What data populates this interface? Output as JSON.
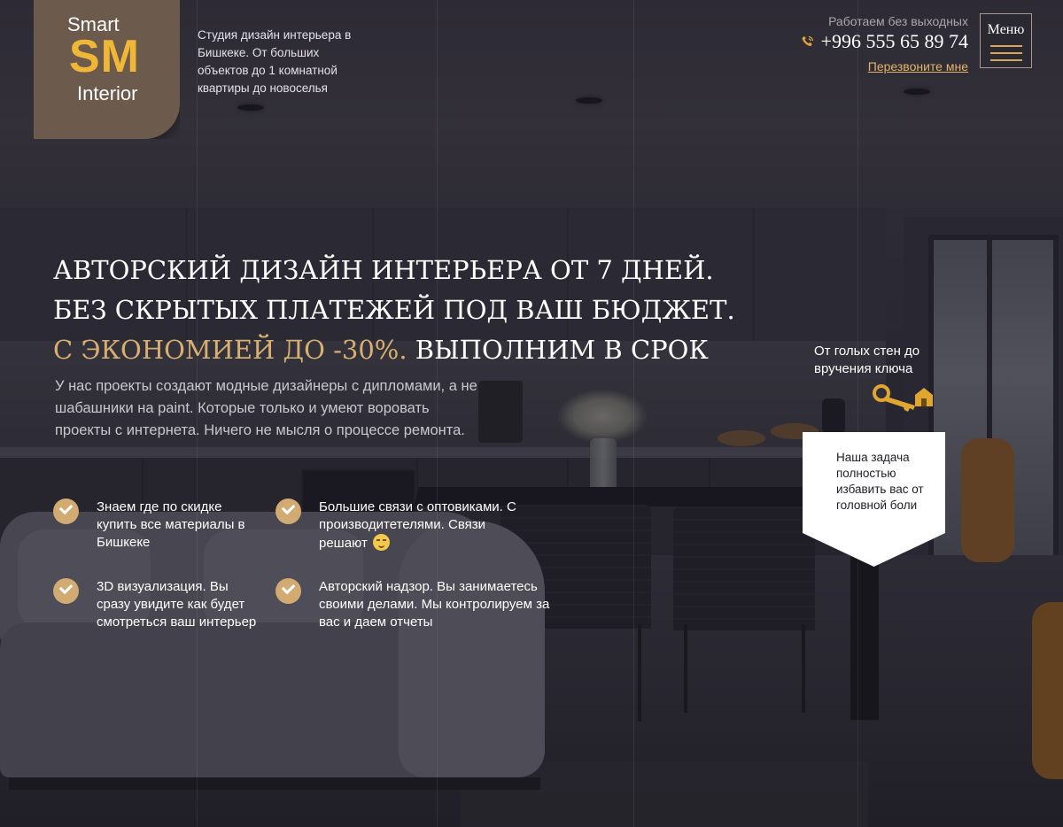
{
  "header": {
    "logo": {
      "top": "Smart",
      "mark": "SM",
      "bottom": "Interior"
    },
    "tagline": "Студия дизайн интерьера в Бишкеке. От больших объектов до 1 комнатной квартиры до новоселья",
    "work_hours": "Работаем без выходных",
    "phone": "+996 555 65 89 74",
    "callback_label": "Перезвоните мне",
    "menu_label": "Меню"
  },
  "hero": {
    "headline_part1": "АВТОРСКИЙ ДИЗАЙН ИНТЕРЬЕРА ОТ 7 ДНЕЙ. БЕЗ СКРЫТЫХ ПЛАТЕЖЕЙ ПОД ВАШ БЮДЖЕТ. ",
    "headline_accent": "С ЭКОНОМИЕЙ ДО -30%.",
    "headline_part2": " ВЫПОЛНИМ В СРОК",
    "subtext": "У нас проекты создают модные дизайнеры с дипломами, а не шабашники на paint. Которые только и умеют воровать проекты с интернета. Ничего не мысля о процессе ремонта."
  },
  "features": [
    {
      "text": "Знаем где по скидке купить все материалы в Бишкеке"
    },
    {
      "text": "Большие связи с оптовиками. С производитетелями. Связи решают"
    },
    {
      "text": "3D визуализация. Вы сразу увидите как будет смотреться ваш интерьер"
    },
    {
      "text": "Авторский надзор. Вы занимаетесь своими делами. Мы контролируем за вас и даем отчеты"
    }
  ],
  "promo": {
    "key_caption": "От голых стен до вручения ключа",
    "task_text": "Наша задача полностью избавить вас от головной боли"
  },
  "colors": {
    "accent_gold": "#d8af70",
    "logo_brown": "#6c5a4d",
    "logo_yellow": "#f0b636",
    "link_gold": "#e0b46a"
  },
  "icons": [
    "phone-icon",
    "hamburger-icon",
    "check-icon",
    "smirk-emoji-icon",
    "key-house-icon"
  ]
}
